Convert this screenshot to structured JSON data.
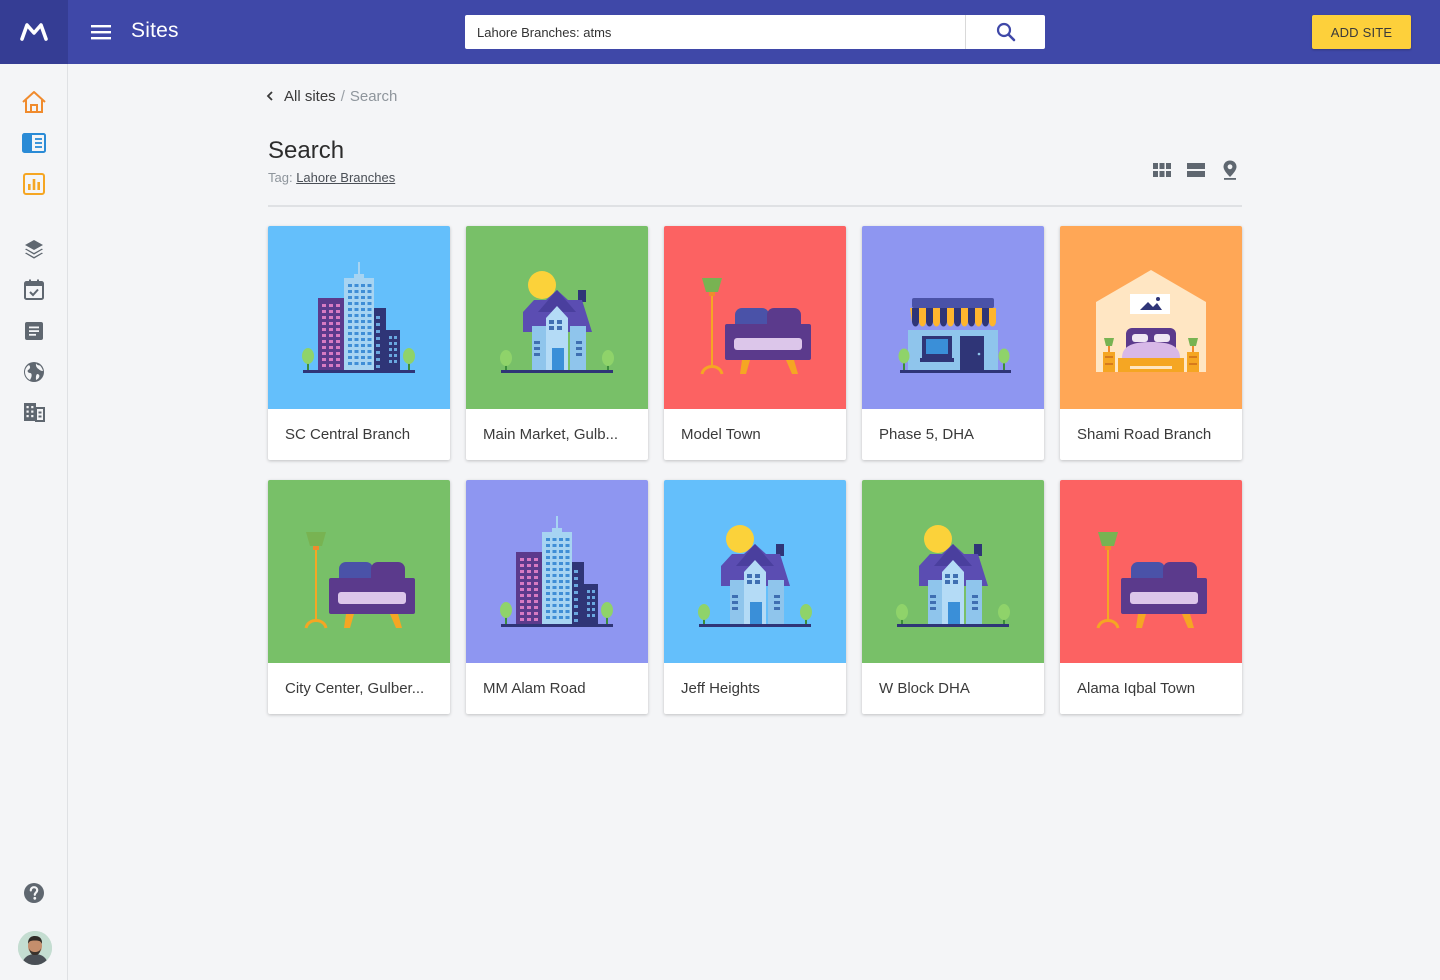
{
  "header": {
    "title": "Sites",
    "search_value": "Lahore Branches: atms",
    "add_label": "ADD SITE",
    "brand_color": "#3f48a8",
    "accent_color": "#fdd03b"
  },
  "sidebar": {
    "items": [
      {
        "icon": "home-icon"
      },
      {
        "icon": "book-icon"
      },
      {
        "icon": "chart-icon"
      },
      {
        "icon": "layers-icon"
      },
      {
        "icon": "calendar-icon"
      },
      {
        "icon": "document-icon"
      },
      {
        "icon": "globe-icon"
      },
      {
        "icon": "building-icon"
      },
      {
        "icon": "help-icon"
      }
    ]
  },
  "breadcrumb": {
    "parent": "All sites",
    "separator": "/",
    "current": "Search"
  },
  "page": {
    "title": "Search",
    "tag_label": "Tag:",
    "tag_value": "Lahore Branches"
  },
  "view_modes": [
    "grid-view-icon",
    "list-view-icon",
    "map-view-icon"
  ],
  "sites": [
    {
      "name": "SC Central Branch",
      "image": "skyscraper",
      "bg": "#64bffb"
    },
    {
      "name": "Main Market, Gulb...",
      "image": "house",
      "bg": "#78c068"
    },
    {
      "name": "Model Town",
      "image": "sofa",
      "bg": "#fc6262"
    },
    {
      "name": "Phase 5, DHA",
      "image": "shop",
      "bg": "#8e96f1"
    },
    {
      "name": "Shami Road Branch",
      "image": "bedroom",
      "bg": "#ffa756"
    },
    {
      "name": "City Center, Gulber...",
      "image": "sofa",
      "bg": "#78c068"
    },
    {
      "name": "MM Alam Road",
      "image": "skyscraper",
      "bg": "#8e96f1"
    },
    {
      "name": "Jeff Heights",
      "image": "house",
      "bg": "#64bffb"
    },
    {
      "name": "W Block DHA",
      "image": "house",
      "bg": "#78c068"
    },
    {
      "name": "Alama Iqbal Town",
      "image": "sofa",
      "bg": "#fc6262"
    }
  ]
}
